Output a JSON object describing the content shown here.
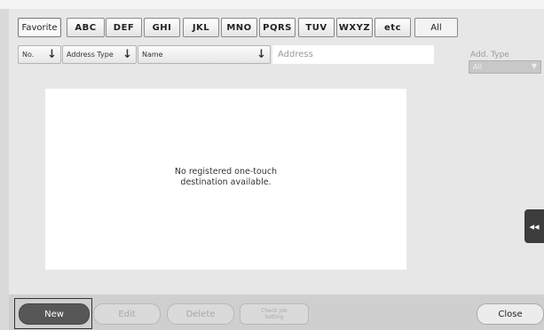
{
  "index_tabs": [
    {
      "label": "Favorite",
      "selected": true
    },
    {
      "label": "ABC"
    },
    {
      "label": "DEF"
    },
    {
      "label": "GHI"
    },
    {
      "label": "JKL"
    },
    {
      "label": "MNO"
    },
    {
      "label": "PQRS"
    },
    {
      "label": "TUV"
    },
    {
      "label": "WXYZ"
    },
    {
      "label": "etc"
    },
    {
      "label": "All"
    }
  ],
  "columns": {
    "no_label": "No.",
    "address_type_label": "Address Type",
    "name_label": "Name",
    "address_label": "Address",
    "sort_icon": "down-arrow-icon"
  },
  "add_type": {
    "label": "Add. Type",
    "selected": "All"
  },
  "list": {
    "empty_message_line1": "No registered one-touch",
    "empty_message_line2": "destination available."
  },
  "side_tab": {
    "icon": "double-left-arrow-icon",
    "glyph": "◂◂"
  },
  "footer": {
    "new_label": "New",
    "edit_label": "Edit",
    "delete_label": "Delete",
    "check_job_line1": "Check Job",
    "check_job_line2": "Setting",
    "close_label": "Close"
  },
  "colors": {
    "selected_button": "#575757",
    "disabled_text": "#a8a8a8",
    "background": "#d9d9d9"
  }
}
